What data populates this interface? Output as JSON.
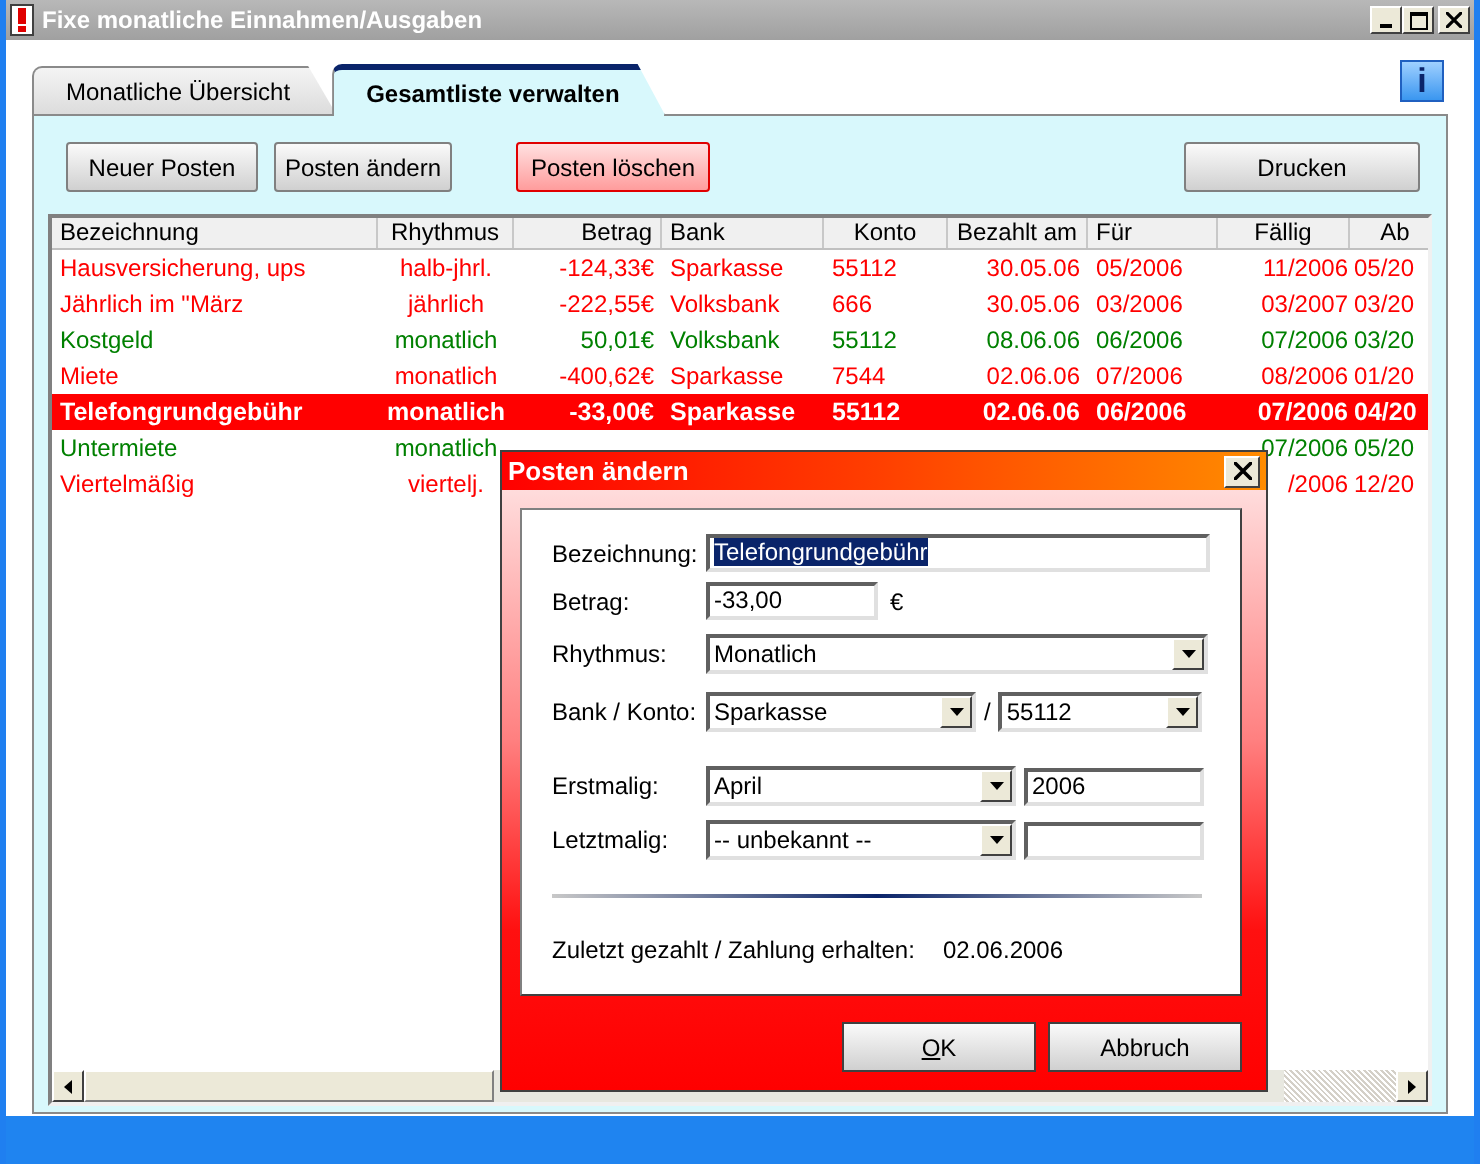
{
  "window": {
    "title": "Fixe monatliche Einnahmen/Ausgaben"
  },
  "tabs": [
    {
      "label": "Monatliche Übersicht",
      "selected": false
    },
    {
      "label": "Gesamtliste verwalten",
      "selected": true
    }
  ],
  "info_button": {
    "label": "i"
  },
  "toolbar": [
    {
      "label": "Neuer Posten",
      "kind": "normal"
    },
    {
      "label": "Posten ändern",
      "kind": "normal"
    },
    {
      "label": "Posten löschen",
      "kind": "danger"
    },
    {
      "label": "Drucken",
      "kind": "print"
    }
  ],
  "table": {
    "columns": [
      "Bezeichnung",
      "Rhythmus",
      "Betrag",
      "Bank",
      "Konto",
      "Bezahlt am",
      "Für",
      "Fällig",
      "Ab"
    ],
    "rows": [
      {
        "cells": [
          "Hausversicherung, ups",
          "halb-jhrl.",
          "-124,33€",
          "Sparkasse",
          "55112",
          "30.05.06",
          "05/2006",
          "11/2006",
          "05/20"
        ],
        "color": "#ff0000",
        "selected": false
      },
      {
        "cells": [
          "Jährlich im \"März",
          "jährlich",
          "-222,55€",
          "Volksbank",
          "666",
          "30.05.06",
          "03/2006",
          "03/2007",
          "03/20"
        ],
        "color": "#ff0000",
        "selected": false
      },
      {
        "cells": [
          "Kostgeld",
          "monatlich",
          "50,01€",
          "Volksbank",
          "55112",
          "08.06.06",
          "06/2006",
          "07/2006",
          "03/20"
        ],
        "color": "#008000",
        "selected": false
      },
      {
        "cells": [
          "Miete",
          "monatlich",
          "-400,62€",
          "Sparkasse",
          "7544",
          "02.06.06",
          "07/2006",
          "08/2006",
          "01/20"
        ],
        "color": "#ff0000",
        "selected": false
      },
      {
        "cells": [
          "Telefongrundgebühr",
          "monatlich",
          "-33,00€",
          "Sparkasse",
          "55112",
          "02.06.06",
          "06/2006",
          "07/2006",
          "04/20"
        ],
        "color": "#ff0000",
        "selected": true
      },
      {
        "cells": [
          "Untermiete",
          "monatlich",
          null,
          null,
          null,
          null,
          null,
          "07/2006",
          "05/20"
        ],
        "color": "#008000",
        "selected": false
      },
      {
        "cells": [
          "Viertelmäßig",
          "viertelj.",
          null,
          null,
          null,
          null,
          null,
          "/2006",
          "12/20"
        ],
        "color": "#ff0000",
        "selected": false
      }
    ]
  },
  "dialog": {
    "title": "Posten ändern",
    "name": {
      "label": "Bezeichnung:",
      "value": "Telefongrundgebühr",
      "text_selected": true
    },
    "amount": {
      "label": "Betrag:",
      "value": "-33,00",
      "unit": "€"
    },
    "rhythm": {
      "label": "Rhythmus:",
      "value": "Monatlich"
    },
    "bank_account": {
      "label": "Bank / Konto:",
      "bank": "Sparkasse",
      "separator": "/",
      "account": "55112"
    },
    "first": {
      "label": "Erstmalig:",
      "month": "April",
      "year": "2006"
    },
    "last": {
      "label": "Letztmalig:",
      "month": "-- unbekannt --"
    },
    "last_paid": {
      "label": "Zuletzt gezahlt / Zahlung erhalten:",
      "value": "02.06.2006"
    },
    "buttons": [
      {
        "label": "OK",
        "mnemonic": true
      },
      {
        "label": "Abbruch",
        "mnemonic": false
      }
    ]
  }
}
